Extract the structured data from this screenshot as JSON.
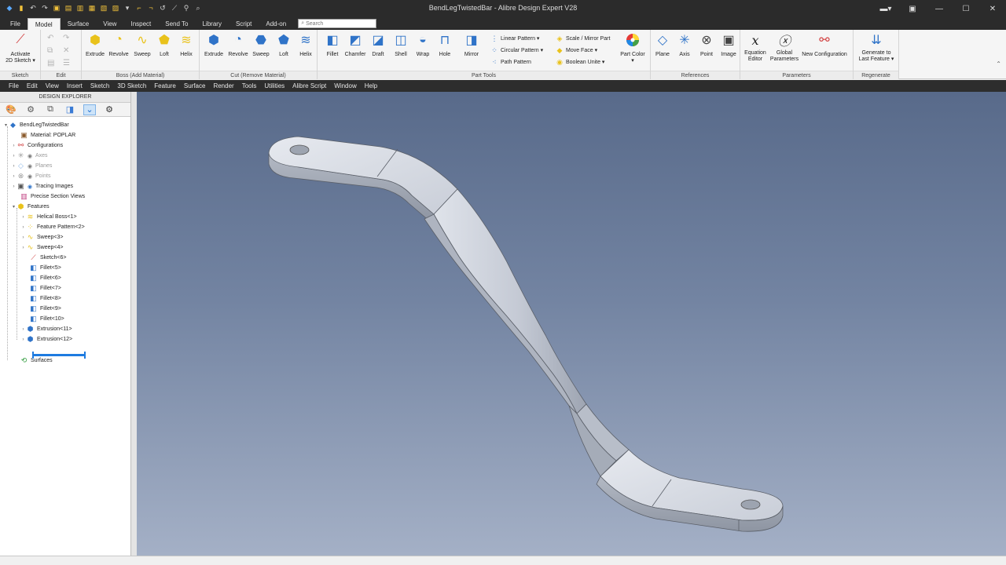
{
  "window": {
    "title": "BendLegTwistedBar - Alibre Design Expert V28"
  },
  "ribbon_tabs": [
    "File",
    "Model",
    "Surface",
    "View",
    "Inspect",
    "Send To",
    "Library",
    "Script",
    "Add-on"
  ],
  "search": {
    "placeholder": "Search"
  },
  "ribbon": {
    "sketch": {
      "label": "Sketch",
      "activate": "Activate\n2D Sketch ▾"
    },
    "edit": {
      "label": "Edit"
    },
    "boss": {
      "label": "Boss (Add Material)",
      "buttons": [
        "Extrude",
        "Revolve",
        "Sweep",
        "Loft",
        "Helix"
      ]
    },
    "cut": {
      "label": "Cut (Remove Material)",
      "buttons": [
        "Extrude",
        "Revolve",
        "Sweep",
        "Loft",
        "Helix"
      ]
    },
    "part_tools": {
      "label": "Part Tools",
      "buttons": [
        "Fillet",
        "Chamfer",
        "Draft",
        "Shell",
        "Wrap",
        "Hole",
        "Mirror"
      ],
      "patterns": [
        "Linear Pattern ▾",
        "Circular Pattern ▾",
        "Path Pattern"
      ],
      "modify": [
        "Scale / Mirror Part",
        "Move Face ▾",
        "Boolean Unite ▾"
      ],
      "color": "Part Color"
    },
    "references": {
      "label": "References",
      "buttons": [
        "Plane",
        "Axis",
        "Point",
        "Image"
      ]
    },
    "parameters": {
      "label": "Parameters",
      "buttons": [
        "Equation\nEditor",
        "Global\nParameters",
        "New Configuration"
      ]
    },
    "regenerate": {
      "label": "Regenerate",
      "button": "Generate to\nLast Feature ▾"
    }
  },
  "menus": [
    "File",
    "Edit",
    "View",
    "Insert",
    "Sketch",
    "3D Sketch",
    "Feature",
    "Surface",
    "Render",
    "Tools",
    "Utilities",
    "Alibre Script",
    "Window",
    "Help"
  ],
  "explorer": {
    "title": "DESIGN EXPLORER",
    "root": "BendLegTwistedBar",
    "items": [
      "Material: POPLAR",
      "Configurations",
      "Axes",
      "Planes",
      "Points",
      "Tracing Images",
      "Precise Section Views",
      "Features",
      "Helical Boss<1>",
      "Feature Pattern<2>",
      "Sweep<3>",
      "Sweep<4>",
      "Sketch<6>",
      "Fillet<5>",
      "Fillet<6>",
      "Fillet<7>",
      "Fillet<8>",
      "Fillet<9>",
      "Fillet<10>",
      "Extrusion<11>",
      "Extrusion<12>",
      "Surfaces"
    ]
  }
}
